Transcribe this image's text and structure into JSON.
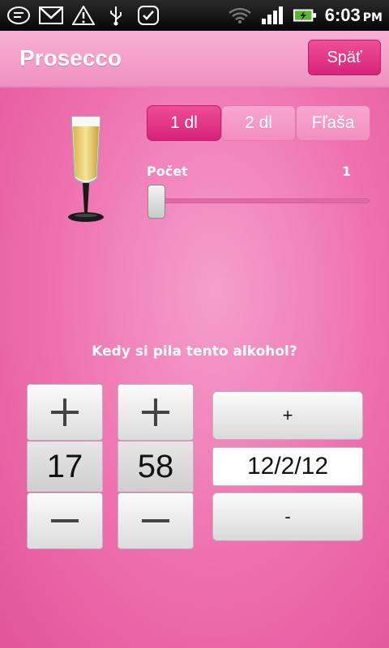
{
  "status_bar": {
    "time": "6:03",
    "ampm": "PM",
    "icons": [
      "notification-icon",
      "gmail-icon",
      "warning-icon",
      "usb-icon",
      "check-icon",
      "wifi-icon",
      "signal-icon",
      "battery-charging-icon"
    ]
  },
  "header": {
    "title": "Prosecco",
    "back_label": "Späť"
  },
  "volume": {
    "options": [
      "1 dl",
      "2 dl",
      "Fľaša"
    ],
    "selected": "1 dl"
  },
  "count": {
    "label": "Počet",
    "value": "1"
  },
  "question": "Kedy si pila tento alkohol?",
  "time_picker": {
    "hour": "17",
    "minute": "58",
    "plus_symbol": "+",
    "minus_symbol": "−"
  },
  "date_picker": {
    "date": "12/2/12",
    "plus_label": "+",
    "minus_label": "-"
  },
  "colors": {
    "accent": "#d6237a",
    "background": "#ee6fae",
    "header": "#f4a0c9"
  }
}
